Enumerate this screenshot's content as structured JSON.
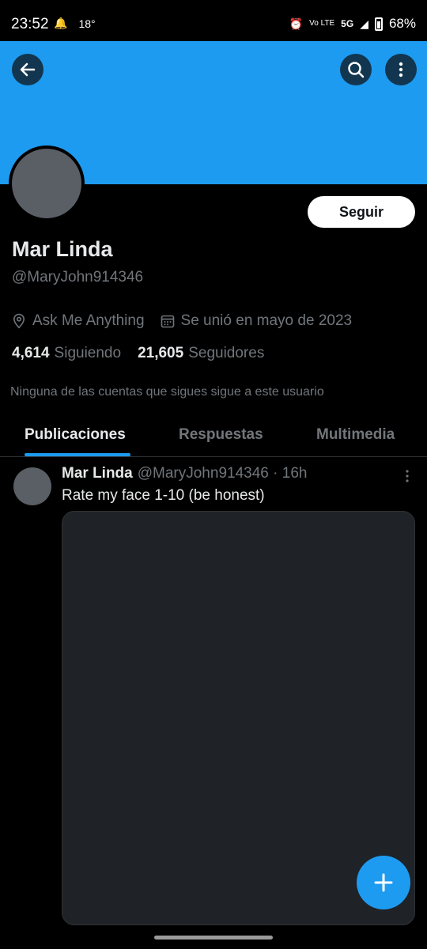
{
  "status": {
    "time": "23:52",
    "temp": "18°",
    "network": "5G",
    "volte": "Vo LTE",
    "battery": "68%"
  },
  "profile": {
    "name": "Mar Linda",
    "handle": "@MaryJohn914346",
    "location": "Ask Me Anything",
    "joined": "Se unió en mayo de 2023",
    "following_count": "4,614",
    "following_label": "Siguiendo",
    "followers_count": "21,605",
    "followers_label": "Seguidores",
    "followed_by_note": "Ninguna de las cuentas que sigues sigue a este usuario",
    "follow_button": "Seguir"
  },
  "tabs": [
    "Publicaciones",
    "Respuestas",
    "Multimedia"
  ],
  "post": {
    "name": "Mar Linda",
    "handle": "@MaryJohn914346",
    "time": "16h",
    "text": "Rate my face 1-10 (be honest)"
  },
  "colors": {
    "accent": "#1d9bf0",
    "background": "#000000",
    "muted": "#71767b",
    "text": "#e7e9ea"
  },
  "icons": {
    "back": "arrow-left-icon",
    "search": "search-icon",
    "more": "more-vertical-icon",
    "location": "location-pin-icon",
    "calendar": "calendar-icon",
    "compose": "plus-icon"
  }
}
